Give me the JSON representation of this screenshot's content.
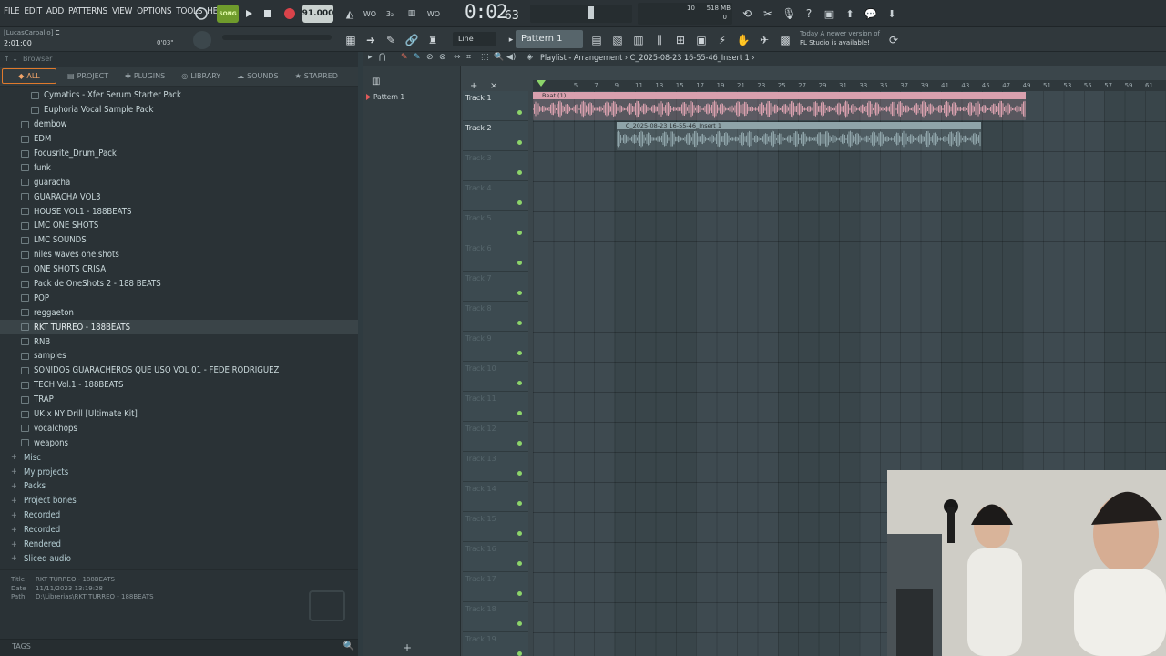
{
  "menu": [
    "FILE",
    "EDIT",
    "ADD",
    "PATTERNS",
    "VIEW",
    "OPTIONS",
    "TOOLS",
    "HELP"
  ],
  "transport": {
    "tempo": "91.000",
    "time": "0:02",
    "time_sub": "63",
    "song_label": "SONG",
    "mem": "518 MB",
    "cpu": "10",
    "poly": "0"
  },
  "hint": {
    "user": "[LucasCarballo]",
    "key": "C",
    "pos": "2:01:00",
    "len": "0'03\""
  },
  "toolbar2": {
    "snap": "Line",
    "pattern": "Pattern 1",
    "news_line1": "Today  A newer version of",
    "news_line2": "FL Studio is available!"
  },
  "browser": {
    "header": "Browser",
    "tabs": [
      "ALL",
      "PROJECT",
      "PLUGINS",
      "LIBRARY",
      "SOUNDS",
      "STARRED"
    ],
    "items": [
      {
        "label": "Cymatics - Xfer Serum Starter Pack",
        "indent": 2,
        "type": "folder"
      },
      {
        "label": "Euphoria Vocal Sample Pack",
        "indent": 2,
        "type": "folder"
      },
      {
        "label": "dembow",
        "indent": 1,
        "type": "folder"
      },
      {
        "label": "EDM",
        "indent": 1,
        "type": "folder"
      },
      {
        "label": "Focusrite_Drum_Pack",
        "indent": 1,
        "type": "folder"
      },
      {
        "label": "funk",
        "indent": 1,
        "type": "folder"
      },
      {
        "label": "guaracha",
        "indent": 1,
        "type": "folder"
      },
      {
        "label": "GUARACHA VOL3",
        "indent": 1,
        "type": "folder"
      },
      {
        "label": "HOUSE VOL1 - 188BEATS",
        "indent": 1,
        "type": "folder"
      },
      {
        "label": "LMC ONE SHOTS",
        "indent": 1,
        "type": "folder"
      },
      {
        "label": "LMC SOUNDS",
        "indent": 1,
        "type": "folder"
      },
      {
        "label": "niles waves one shots",
        "indent": 1,
        "type": "folder"
      },
      {
        "label": "ONE SHOTS CRISA",
        "indent": 1,
        "type": "folder"
      },
      {
        "label": "Pack de OneShots 2 - 188 BEATS",
        "indent": 1,
        "type": "folder"
      },
      {
        "label": "POP",
        "indent": 1,
        "type": "folder"
      },
      {
        "label": "reggaeton",
        "indent": 1,
        "type": "folder"
      },
      {
        "label": "RKT  TURREO - 188BEATS",
        "indent": 1,
        "type": "folder",
        "selected": true
      },
      {
        "label": "RNB",
        "indent": 1,
        "type": "folder"
      },
      {
        "label": "samples",
        "indent": 1,
        "type": "folder"
      },
      {
        "label": "SONIDOS GUARACHEROS QUE USO VOL 01 - FEDE RODRIGUEZ",
        "indent": 1,
        "type": "folder"
      },
      {
        "label": "TECH Vol.1 - 188BEATS",
        "indent": 1,
        "type": "folder"
      },
      {
        "label": "TRAP",
        "indent": 1,
        "type": "folder"
      },
      {
        "label": "UK x NY Drill [Ultimate Kit]",
        "indent": 1,
        "type": "folder"
      },
      {
        "label": "vocalchops",
        "indent": 1,
        "type": "folder"
      },
      {
        "label": "weapons",
        "indent": 1,
        "type": "folder"
      },
      {
        "label": "Misc",
        "indent": 0,
        "type": "top"
      },
      {
        "label": "My projects",
        "indent": 0,
        "type": "top"
      },
      {
        "label": "Packs",
        "indent": 0,
        "type": "top"
      },
      {
        "label": "Project bones",
        "indent": 0,
        "type": "top"
      },
      {
        "label": "Recorded",
        "indent": 0,
        "type": "top"
      },
      {
        "label": "Recorded",
        "indent": 0,
        "type": "top"
      },
      {
        "label": "Rendered",
        "indent": 0,
        "type": "top"
      },
      {
        "label": "Sliced audio",
        "indent": 0,
        "type": "top"
      }
    ],
    "info": {
      "title": "RKT  TURREO - 188BEATS",
      "date": "11/11/2023 13:19:28",
      "path": "D:\\Librerias\\RKT  TURREO - 188BEATS"
    },
    "tags_label": "TAGS"
  },
  "playlist": {
    "title": "Playlist - Arrangement",
    "breadcrumb": "C_2025-08-23 16-55-46_Insert 1",
    "pattern_item": "Pattern 1",
    "ruler": [
      "5",
      "7",
      "9",
      "11",
      "13",
      "15",
      "17",
      "19",
      "21",
      "23",
      "25",
      "27",
      "29",
      "31",
      "33",
      "35",
      "37",
      "39",
      "41",
      "43",
      "45",
      "47",
      "49",
      "51",
      "53",
      "55",
      "57",
      "59",
      "61"
    ],
    "tracks": [
      "Track 1",
      "Track 2",
      "Track 3",
      "Track 4",
      "Track 5",
      "Track 6",
      "Track 7",
      "Track 8",
      "Track 9",
      "Track 10",
      "Track 11",
      "Track 12",
      "Track 13",
      "Track 14",
      "Track 15",
      "Track 16",
      "Track 17",
      "Track 18",
      "Track 19"
    ],
    "clips": [
      {
        "label": "Beat (1)",
        "track": 0,
        "start": 1,
        "end": 49.3,
        "color": "#d9a0ae"
      },
      {
        "label": "C_2025-08-23 16-55-46_Insert 1",
        "track": 1,
        "start": 9.2,
        "end": 44.9,
        "color": "#8fa4a9"
      }
    ]
  }
}
